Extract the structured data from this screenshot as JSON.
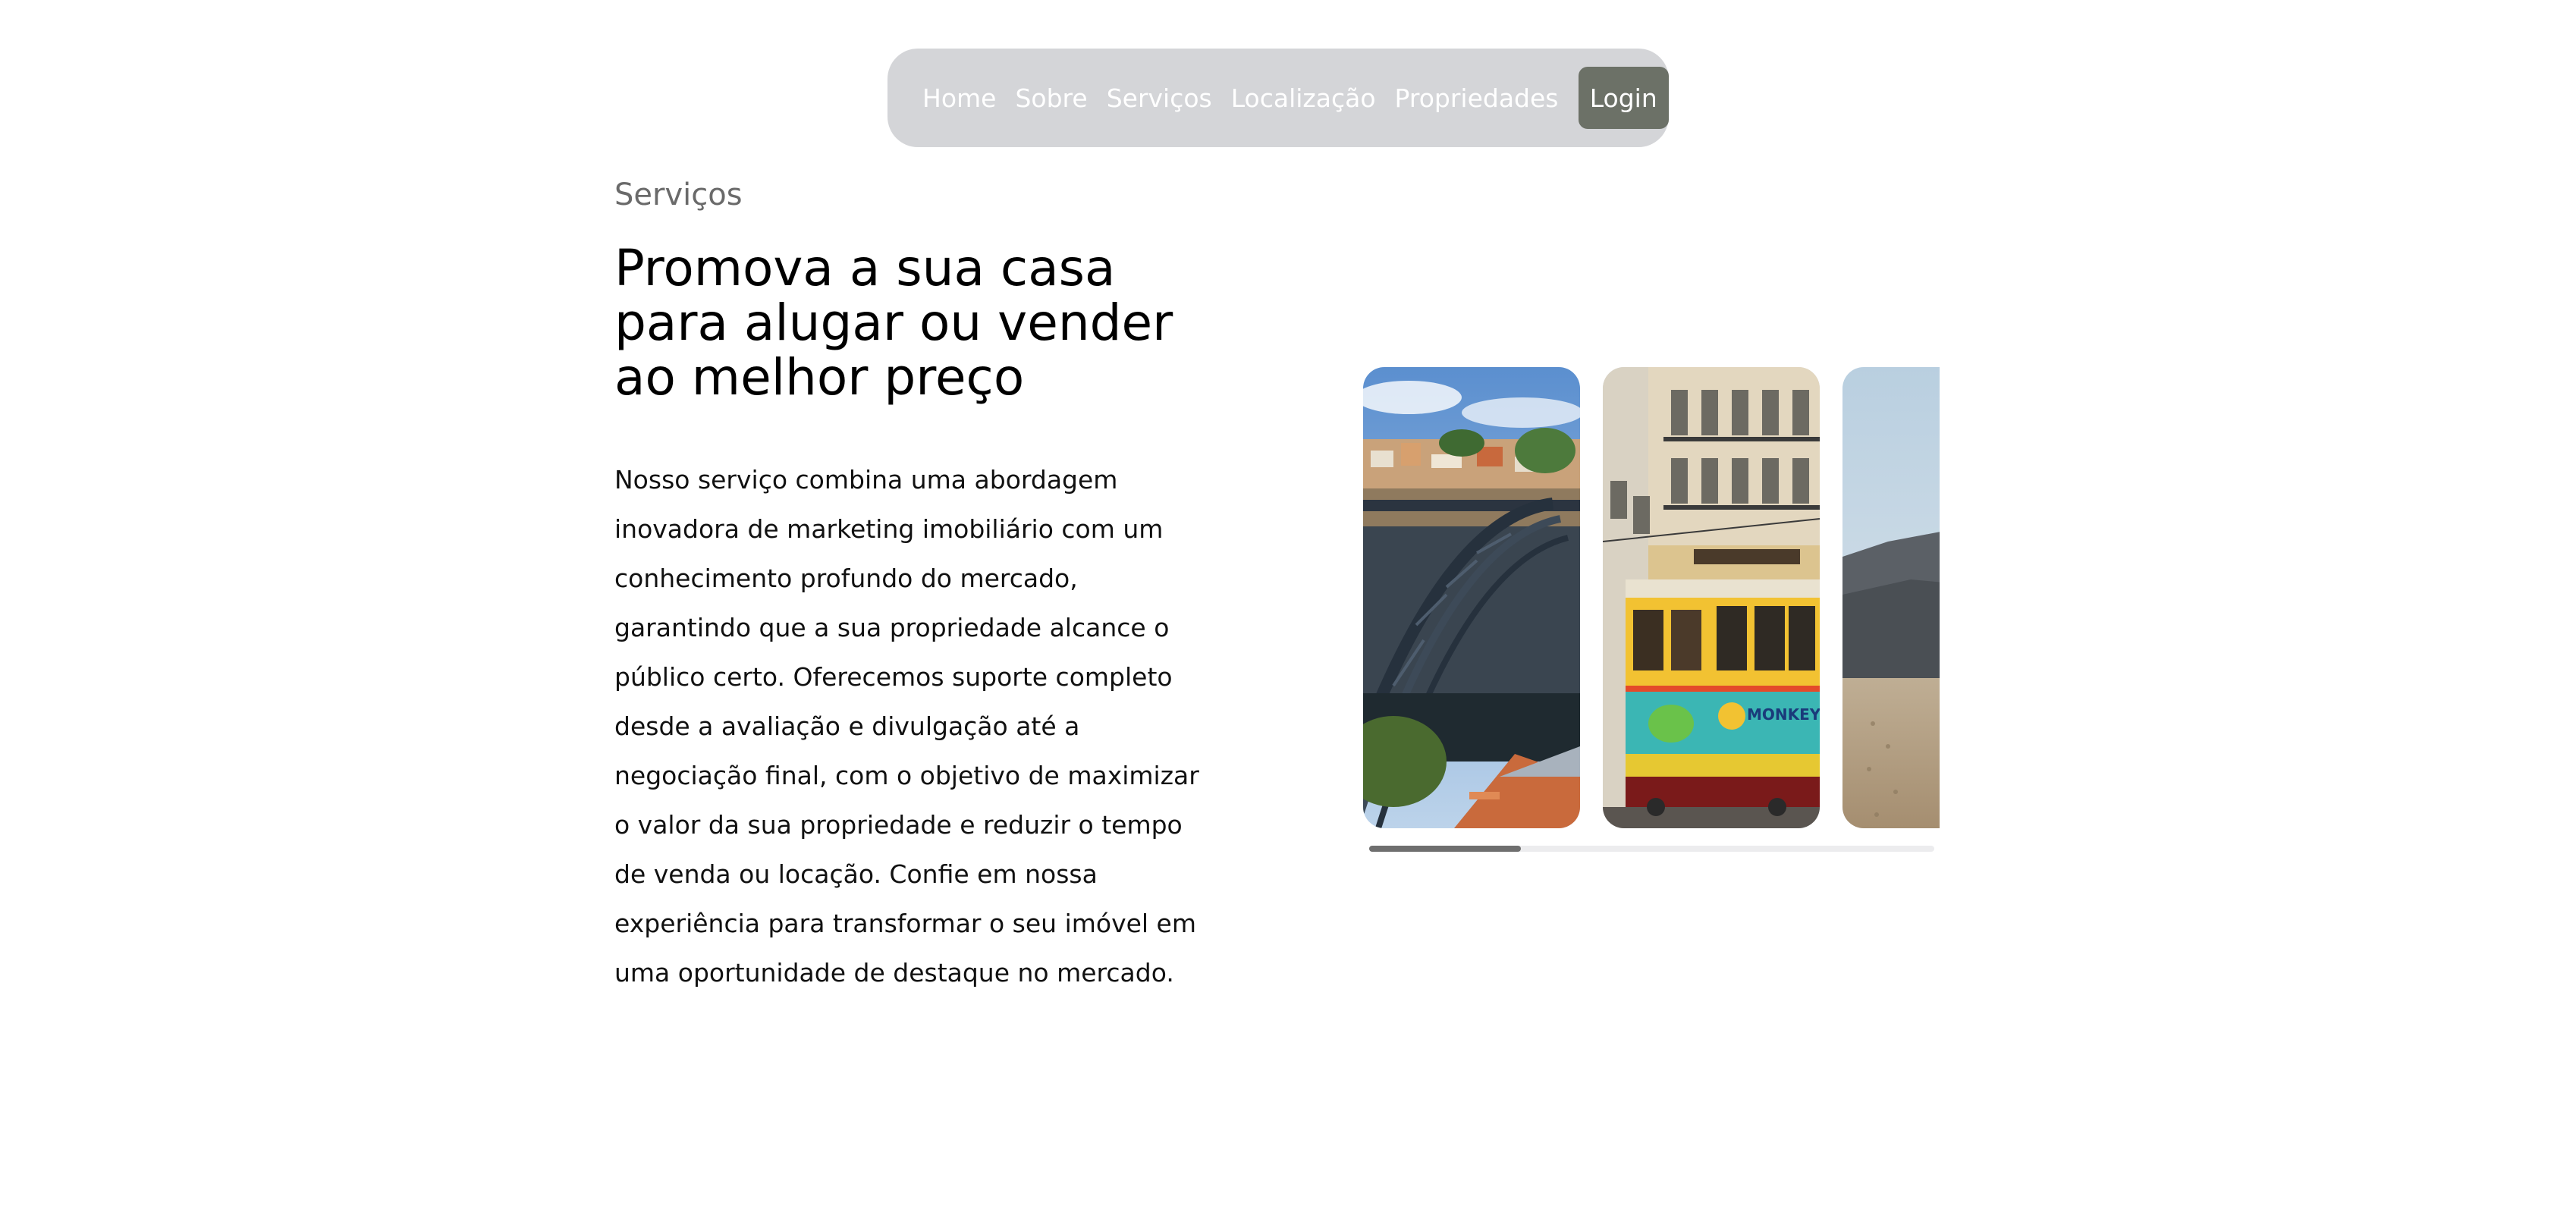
{
  "nav": {
    "links": [
      "Home",
      "Sobre",
      "Serviços",
      "Localização",
      "Propriedades"
    ],
    "login_label": "Login"
  },
  "services": {
    "section_label": "Serviços",
    "headline": "Promova a sua casa para alugar ou vender ao melhor preço",
    "body": "Nosso serviço combina uma abordagem inovadora de marketing imobiliário com um conhecimento profundo do mercado, garantindo que a sua propriedade alcance o público certo. Oferecemos suporte completo desde a avaliação e divulgação até a negociação final, com o objetivo de maximizar o valor da sua propriedade e reduzir o tempo de venda ou locação. Confie em nossa experiência para transformar o seu imóvel em uma oportunidade de destaque no mercado."
  },
  "carousel": {
    "slides": [
      "porto-bridge-photo",
      "lisbon-tram-photo",
      "coastal-beach-photo"
    ],
    "scroll_position_fraction": 0.27
  },
  "colors": {
    "nav_background": "#d4d5d8",
    "login_background": "#6c7167",
    "section_label": "#6a6a6a"
  }
}
